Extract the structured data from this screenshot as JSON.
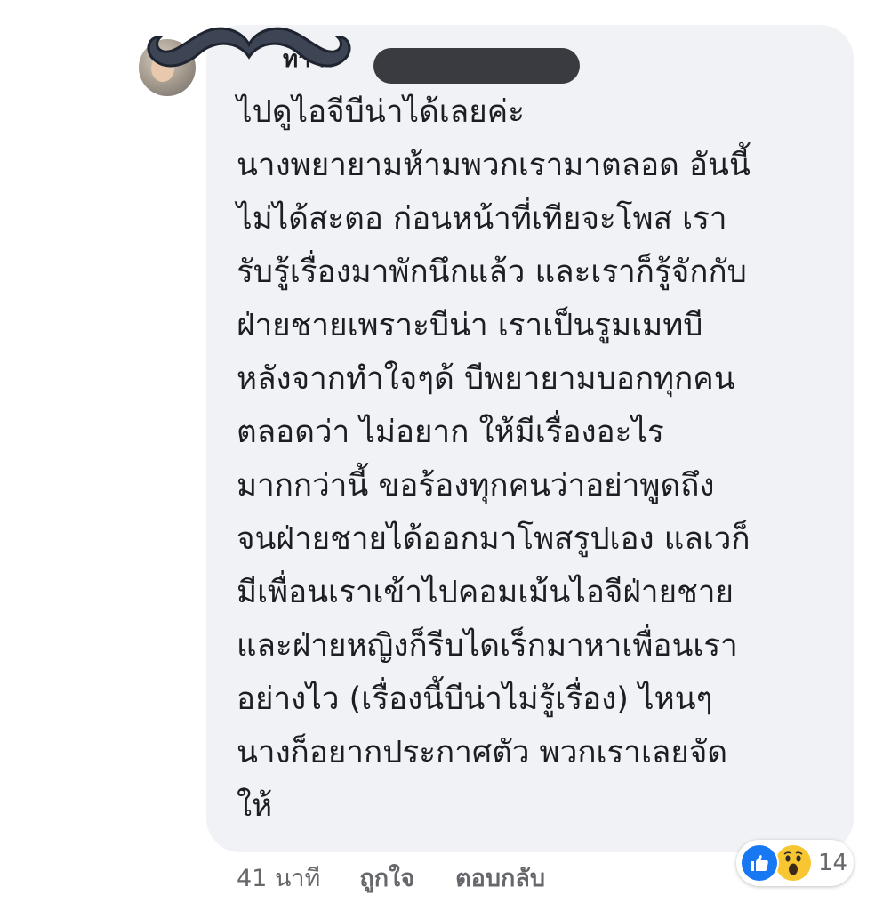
{
  "comment": {
    "author_name": "ทา ก",
    "text_lines": [
      "ไปดูไอจีบีน่าได้เลยค่ะ",
      "นางพยายามห้ามพวกเรามาตลอด อันนี้",
      "ไม่ได้สะตอ ก่อนหน้าที่เทียจะโพส เรา",
      "รับรู้เรื่องมาพักนึกแล้ว และเราก็รู้จักกับ",
      "ฝ่ายชายเพราะบีน่า เราเป็นรูมเมทบี",
      "หลังจากทำใจๆด้ บีพยายามบอกทุกคน",
      "ตลอดว่า ไม่อยาก ให้มีเรื่องอะไร",
      "มากกว่านี้ ขอร้องทุกคนว่าอย่าพูดถึง",
      "จนฝ่ายชายได้ออกมาโพสรูปเอง แลเวก็",
      "มีเพื่อนเราเข้าไปคอมเม้นไอจีฝ่ายชาย",
      "และฝ่ายหญิงก็รีบไดเร็กมาหาเพื่อนเรา",
      "อย่างไว (เรื่องนี้บีน่าไม่รู้เรื่อง) ไหนๆ",
      "นางก็อยากประกาศตัว พวกเราเลยจัด",
      "ให้"
    ],
    "time": "41 นาที",
    "like_label": "ถูกใจ",
    "reply_label": "ตอบกลับ",
    "reactions": {
      "icons": [
        "like-icon",
        "wow-icon"
      ],
      "count": "14"
    }
  },
  "colors": {
    "bubble_bg": "#f1f2f6",
    "text": "#1c1e21",
    "meta_text": "#65676b",
    "like_blue": "#1877f2",
    "wow_yellow": "#f7c631",
    "redaction": "#3a3b40"
  }
}
